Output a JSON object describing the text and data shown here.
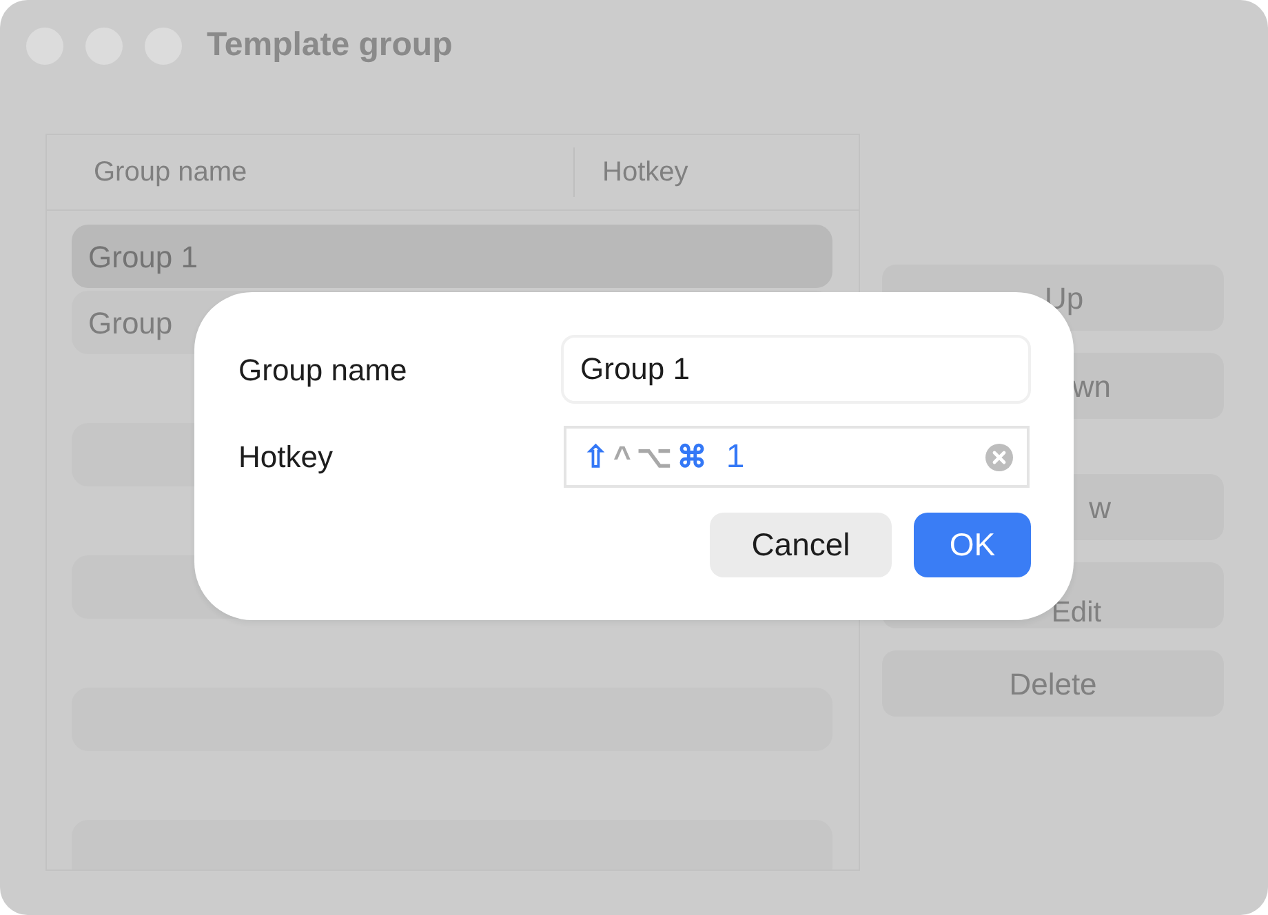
{
  "window": {
    "title": "Template group"
  },
  "table": {
    "columns": [
      "Group name",
      "Hotkey"
    ],
    "rows": [
      {
        "group_name": "Group 1",
        "selected": true
      },
      {
        "group_name": "Group",
        "selected": false
      }
    ]
  },
  "side_buttons": [
    {
      "label": "Up",
      "kind": "full"
    },
    {
      "label": "wn",
      "kind": "partial"
    },
    {
      "label": "w",
      "kind": "partial"
    },
    {
      "label": "Edit",
      "kind": "full"
    },
    {
      "label": "Delete",
      "kind": "full"
    }
  ],
  "dialog": {
    "fields": [
      {
        "label": "Group name",
        "kind": "text",
        "value": "Group 1"
      },
      {
        "label": "Hotkey",
        "kind": "hotkey",
        "modifiers": [
          {
            "symbol": "⇧",
            "on": true
          },
          {
            "symbol": "^",
            "on": false
          },
          {
            "symbol": "⌥",
            "on": false
          },
          {
            "symbol": "⌘",
            "on": true
          }
        ],
        "key": "1"
      }
    ],
    "buttons": [
      {
        "label": "Cancel",
        "kind": "secondary"
      },
      {
        "label": "OK",
        "kind": "primary"
      }
    ]
  }
}
